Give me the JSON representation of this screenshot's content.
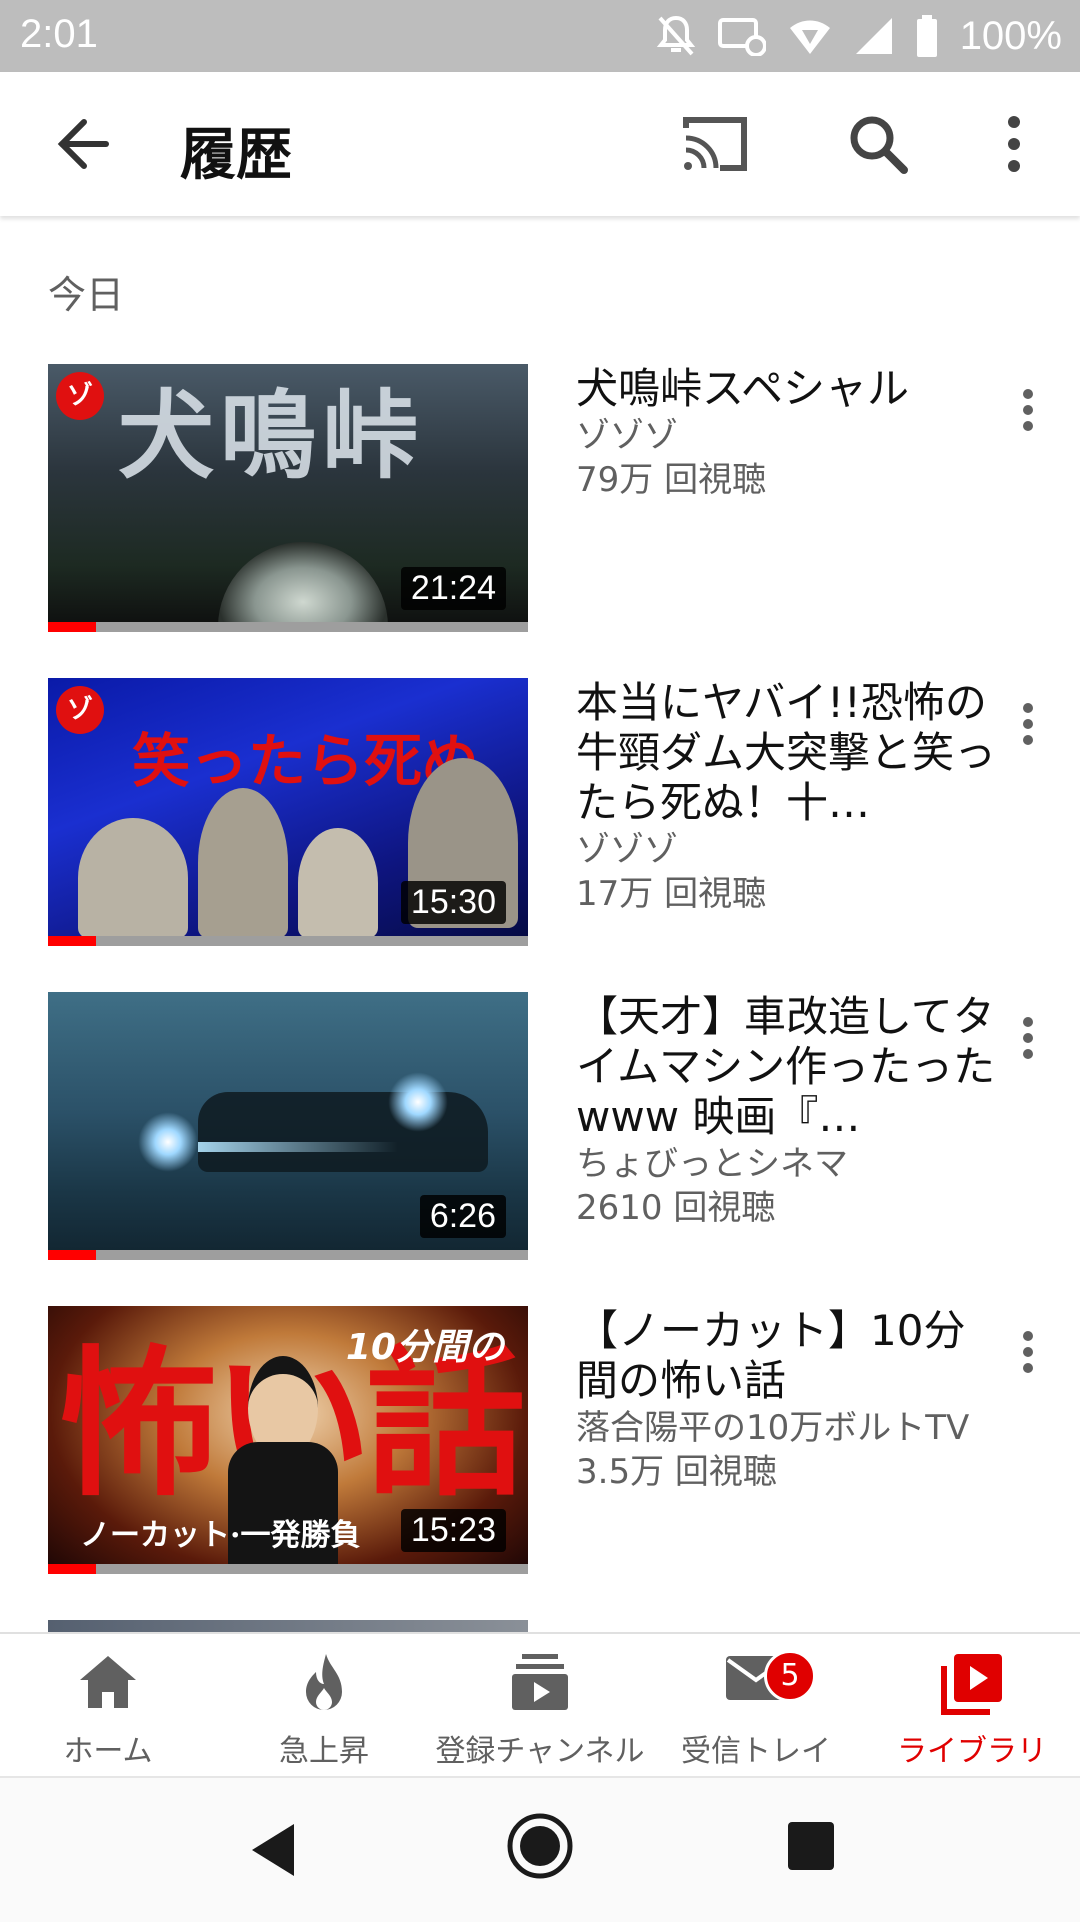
{
  "status_bar": {
    "time": "2:01",
    "battery_percent": "100%"
  },
  "app_bar": {
    "title": "履歴"
  },
  "section": {
    "label": "今日"
  },
  "videos": [
    {
      "title": "犬鳴峠スペシャル",
      "channel": "ゾゾゾ",
      "views": "79万 回視聴",
      "duration": "21:24",
      "watched_fraction": 0.1,
      "thumb_text": "犬鳴峠"
    },
    {
      "title": "本当にヤバイ!!恐怖の牛頸ダム大突撃と笑ったら死ぬ！十…",
      "channel": "ゾゾゾ",
      "views": "17万 回視聴",
      "duration": "15:30",
      "watched_fraction": 0.1,
      "thumb_text": "笑ったら死ぬ"
    },
    {
      "title": "【天才】車改造してタイムマシン作ったったwww 映画『…",
      "channel": "ちょびっとシネマ",
      "views": "2610 回視聴",
      "duration": "6:26",
      "watched_fraction": 0.1
    },
    {
      "title": "【ノーカット】10分間の怖い話",
      "channel": "落合陽平の10万ボルトTV",
      "views": "3.5万 回視聴",
      "duration": "15:23",
      "watched_fraction": 0.1,
      "thumb_text": "怖い話",
      "thumb_subtext": "ノーカット·一発勝負",
      "thumb_corner": "10分間の"
    }
  ],
  "bottom_nav": [
    {
      "label": "ホーム",
      "icon": "home-icon"
    },
    {
      "label": "急上昇",
      "icon": "flame-icon"
    },
    {
      "label": "登録チャンネル",
      "icon": "subscriptions-icon"
    },
    {
      "label": "受信トレイ",
      "icon": "mail-icon",
      "badge": "5"
    },
    {
      "label": "ライブラリ",
      "icon": "library-icon",
      "active": true
    }
  ],
  "colors": {
    "accent": "#e00000",
    "status_bar": "#bdbdbd"
  }
}
